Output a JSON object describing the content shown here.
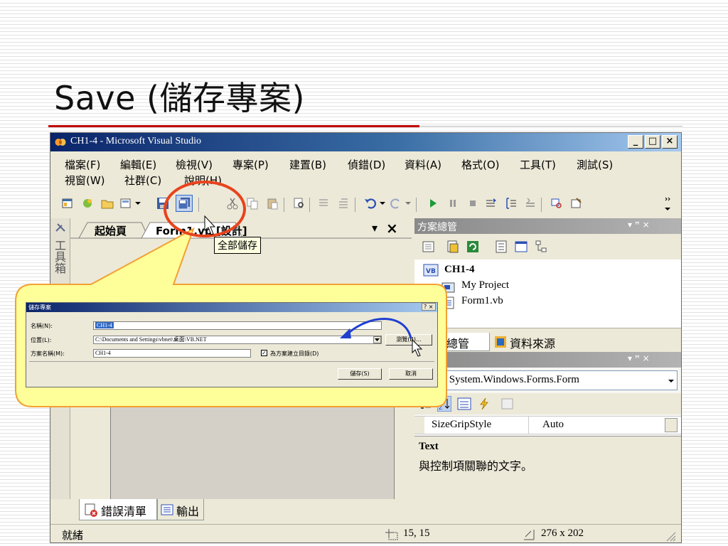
{
  "slide": {
    "title": "Save (儲存專案)"
  },
  "window": {
    "title": "CH1-4 - Microsoft Visual Studio",
    "controls": {
      "minimize": "_",
      "maximize": "□",
      "close": "×"
    }
  },
  "menu": {
    "row1": [
      "檔案(F)",
      "編輯(E)",
      "檢視(V)",
      "專案(P)",
      "建置(B)",
      "偵錯(D)",
      "資料(A)",
      "格式(O)",
      "工具(T)",
      "測試(S)"
    ],
    "row2": [
      "視窗(W)",
      "社群(C)",
      "說明(H)"
    ]
  },
  "toolbar": {
    "tooltip": "全部儲存"
  },
  "left_strip": {
    "label": "工具箱"
  },
  "document": {
    "tabs": [
      "起始頁",
      "Form1.vb [設計]"
    ],
    "tab_controls": {
      "dropdown": "▾",
      "close": "×"
    },
    "form_controls": {
      "minimize": "_",
      "maximize": "□",
      "close": "×"
    }
  },
  "solution_explorer": {
    "header": "方案總管",
    "header_controls": "▾ ꟸ ×",
    "project": "CH1-4",
    "items": [
      "My Project",
      "Form1.vb"
    ],
    "tabs": [
      "方案總管",
      "資料來源"
    ]
  },
  "properties": {
    "object": "Form1 System.Windows.Forms.Form",
    "property_name": "SizeGripStyle",
    "property_value": "Auto",
    "desc_title": "Text",
    "desc_body": "與控制項關聯的文字。"
  },
  "bottom_tabs": [
    "錯誤清單",
    "輸出"
  ],
  "status": {
    "text": "就緒",
    "position": "15, 15",
    "size": "276 x 202"
  },
  "save_dialog": {
    "title": "儲存專案",
    "help_close": "? ×",
    "name_label": "名稱(N):",
    "name_value": "CH1-4",
    "location_label": "位置(L):",
    "location_value": "C:\\Documents and Settings\\vbnet\\桌面\\VB.NET",
    "solution_label": "方案名稱(M):",
    "solution_value": "CH1-4",
    "create_dir_label": "為方案建立目錄(D)",
    "browse_button": "瀏覽(B)...",
    "save_button": "儲存(S)",
    "cancel_button": "取消"
  },
  "colors": {
    "accent_red": "#c00000",
    "annotation_circle": "#e8431c",
    "callout_fill": "#ffff99",
    "callout_border": "#f2a033",
    "arrow": "#1f3fd0"
  }
}
